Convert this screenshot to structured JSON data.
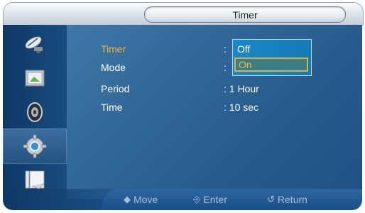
{
  "title": "Timer",
  "menu": {
    "rows": [
      {
        "label": "Timer",
        "value": ""
      },
      {
        "label": "Mode",
        "value": ""
      },
      {
        "label": "Period",
        "value": ": 1 Hour"
      },
      {
        "label": "Time",
        "value": ": 10 sec"
      }
    ],
    "selected_row": "Timer"
  },
  "dropdown": {
    "options": [
      "Off",
      "On"
    ],
    "highlighted": "On"
  },
  "sidebar": {
    "items": [
      {
        "icon": "satellite-dish-icon"
      },
      {
        "icon": "picture-frame-icon"
      },
      {
        "icon": "speaker-icon"
      },
      {
        "icon": "gear-icon",
        "active": true
      },
      {
        "icon": "multi-screen-icon"
      }
    ]
  },
  "hints": {
    "move_label": "Move",
    "enter_label": "Enter",
    "return_label": "Return",
    "move_glyph": "◆",
    "enter_glyph": "⎆",
    "return_glyph": "↺"
  },
  "colors": {
    "selected_text": "#f2b43a",
    "panel_blue": "#2a5f91",
    "dropdown_blue": "#1d88c8",
    "hint_text": "#a9bfd6"
  }
}
